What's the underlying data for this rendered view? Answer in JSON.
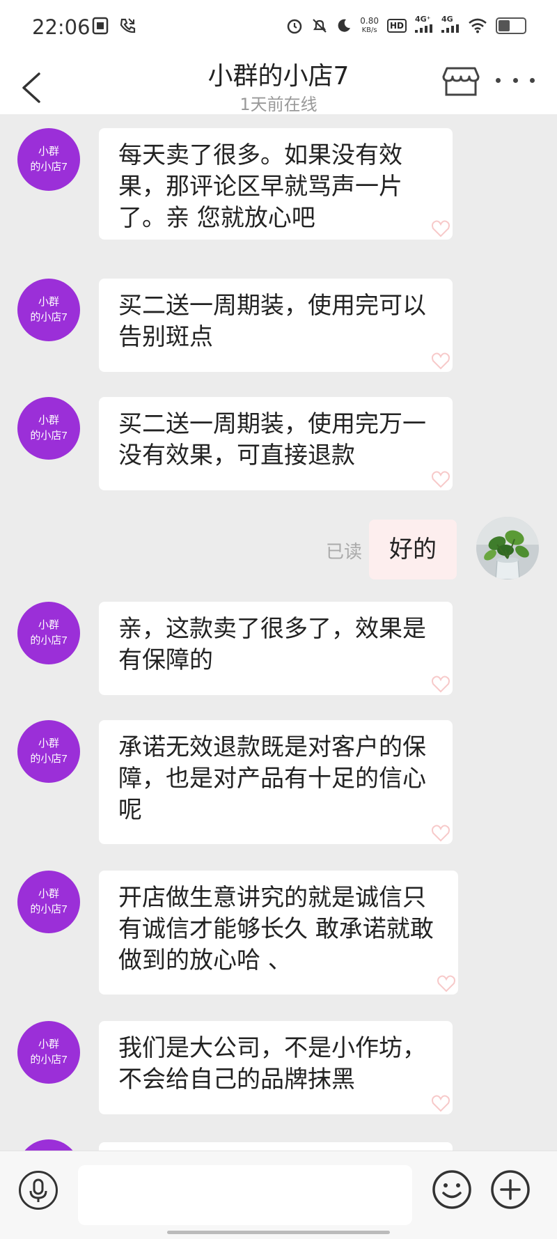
{
  "status_bar": {
    "time": "22:06",
    "left_icons": [
      "sim-card-icon",
      "call-forward-icon"
    ],
    "net_speed_value": "0.80",
    "net_speed_unit": "KB/s",
    "hd_label": "HD",
    "signal_1": "4G⁺",
    "signal_2": "4G",
    "right_icons": [
      "alarm-icon",
      "mute-icon",
      "moon-icon",
      "wifi-icon",
      "battery-icon"
    ]
  },
  "header": {
    "title": "小群的小店7",
    "subtitle": "1天前在线"
  },
  "contact_avatar": {
    "line1": "小群",
    "line2": "的小店7",
    "color": "#9b2fd8"
  },
  "messages": [
    {
      "sender": "shop",
      "text": "每天卖了很多。如果没有效果，那评论区早就骂声一片了。亲  您就放心吧"
    },
    {
      "sender": "shop",
      "text": "买二送一周期装，使用完可以告别斑点"
    },
    {
      "sender": "shop",
      "text": "买二送一周期装，使用完万一没有效果，可直接退款"
    },
    {
      "sender": "me",
      "text": "好的",
      "read_status": "已读"
    },
    {
      "sender": "shop",
      "text": "亲，这款卖了很多了，效果是有保障的"
    },
    {
      "sender": "shop",
      "text": "承诺无效退款既是对客户的保障，也是对产品有十足的信心呢"
    },
    {
      "sender": "shop",
      "text": "开店做生意讲究的就是诚信只有诚信才能够长久  敢承诺就敢做到的放心哈 、"
    },
    {
      "sender": "shop",
      "text": "我们是大公司，不是小作坊，不会给自己的品牌抹黑"
    }
  ],
  "input_bar": {
    "placeholder": "",
    "icons": [
      "microphone-icon",
      "emoji-icon",
      "plus-icon"
    ]
  }
}
